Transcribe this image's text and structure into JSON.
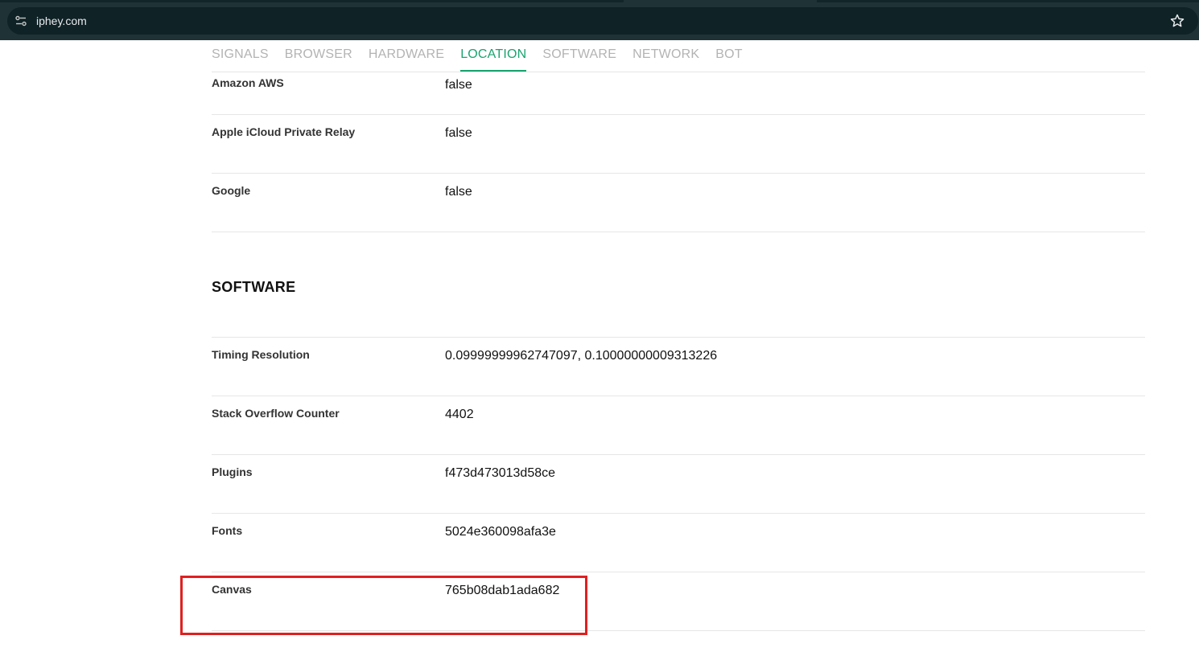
{
  "browser": {
    "url": "iphey.com",
    "site_info_icon": "site-settings-icon",
    "bookmark_icon": "star-icon"
  },
  "nav": {
    "tabs": [
      {
        "label": "SIGNALS"
      },
      {
        "label": "BROWSER"
      },
      {
        "label": "HARDWARE"
      },
      {
        "label": "LOCATION",
        "active": true
      },
      {
        "label": "SOFTWARE"
      },
      {
        "label": "NETWORK"
      },
      {
        "label": "BOT"
      }
    ]
  },
  "location_rows": [
    {
      "label": "Amazon AWS",
      "value": "false"
    },
    {
      "label": "Apple iCloud Private Relay",
      "value": "false"
    },
    {
      "label": "Google",
      "value": "false"
    }
  ],
  "software": {
    "title": "SOFTWARE",
    "rows": [
      {
        "label": "Timing Resolution",
        "value": "0.09999999962747097, 0.10000000009313226"
      },
      {
        "label": "Stack Overflow Counter",
        "value": "4402"
      },
      {
        "label": "Plugins",
        "value": "f473d473013d58ce"
      },
      {
        "label": "Fonts",
        "value": "5024e360098afa3e"
      },
      {
        "label": "Canvas",
        "value": "765b08dab1ada682"
      }
    ]
  },
  "colors": {
    "accent": "#1aa36f",
    "highlight": "#e02020",
    "chrome": "#1f3337"
  }
}
